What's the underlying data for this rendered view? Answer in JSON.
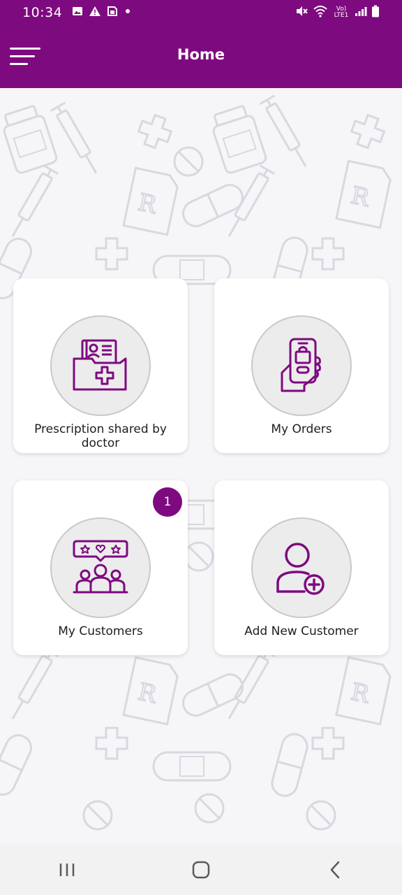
{
  "status_bar": {
    "time": "10:34",
    "network_label": "Vo) LTE1",
    "icons_left": [
      "image-icon",
      "warning-icon",
      "sim-icon",
      "dot-icon"
    ],
    "icons_right": [
      "mute-icon",
      "wifi-icon",
      "signal-icon",
      "battery-icon"
    ]
  },
  "app_bar": {
    "title": "Home",
    "menu_icon": "hamburger-menu-icon"
  },
  "tiles": [
    {
      "label": "Prescription shared by doctor",
      "icon": "prescription-folder-icon"
    },
    {
      "label": "My Orders",
      "icon": "phone-shopping-icon"
    },
    {
      "label": "My Customers",
      "icon": "customers-review-icon",
      "badge": "1"
    },
    {
      "label": "Add New Customer",
      "icon": "add-user-icon"
    }
  ],
  "nav_bar": {
    "icons": [
      "recent-apps-icon",
      "home-icon",
      "back-icon"
    ]
  },
  "colors": {
    "primary": "#7e0a7f",
    "card_background": "#ffffff",
    "icon_circle": "#ececec",
    "nav_background": "#f2f2f2"
  }
}
